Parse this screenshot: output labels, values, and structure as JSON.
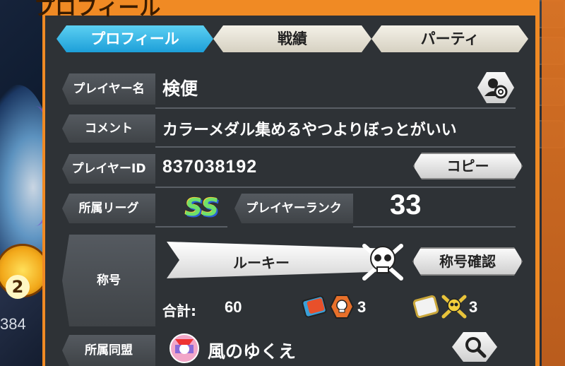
{
  "panel": {
    "title": "プロフィール"
  },
  "tabs": [
    {
      "label": "プロフィール",
      "active": true
    },
    {
      "label": "戦績",
      "active": false
    },
    {
      "label": "パーティ",
      "active": false
    }
  ],
  "profile": {
    "player_name_label": "プレイヤー名",
    "player_name": "検便",
    "comment_label": "コメント",
    "comment": "カラーメダル集めるやつよりぼっとがいい",
    "player_id_label": "プレイヤーID",
    "player_id": "837038192",
    "copy_button": "コピー",
    "league_label": "所属リーグ",
    "league_badge": "SS",
    "rank_label": "プレイヤーランク",
    "rank": "33",
    "title_label": "称号",
    "title_value": "ルーキー",
    "title_confirm_button": "称号確認",
    "total_label": "合計:",
    "total_value": "60",
    "medal_count_1": "3",
    "medal_count_2": "3",
    "alliance_label": "所属同盟",
    "alliance_name": "風のゆくえ"
  },
  "background": {
    "medal_number": "2",
    "left_number": "384"
  },
  "colors": {
    "accent_orange": "#f08a24",
    "tab_active": "#1d9fd9"
  }
}
